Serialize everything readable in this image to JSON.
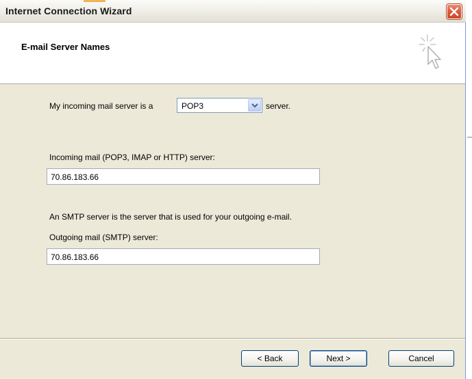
{
  "window": {
    "title": "Internet Connection Wizard",
    "close_icon": "close-icon",
    "titlebar_accent": "#f0b45a",
    "close_color": "#d95b3b"
  },
  "header": {
    "title": "E-mail Server Names",
    "icon": "wizard-cursor-sparkle-icon"
  },
  "form": {
    "incoming_prefix": "My incoming mail server is a",
    "server_type": {
      "selected": "POP3",
      "suffix": "server."
    },
    "incoming_label": "Incoming mail (POP3, IMAP or HTTP) server:",
    "incoming_value": "70.86.183.66",
    "smtp_info": "An SMTP server is the server that is used for your outgoing e-mail.",
    "outgoing_label": "Outgoing mail (SMTP) server:",
    "outgoing_value": "70.86.183.66"
  },
  "buttons": {
    "back": "< Back",
    "next": "Next >",
    "cancel": "Cancel"
  }
}
